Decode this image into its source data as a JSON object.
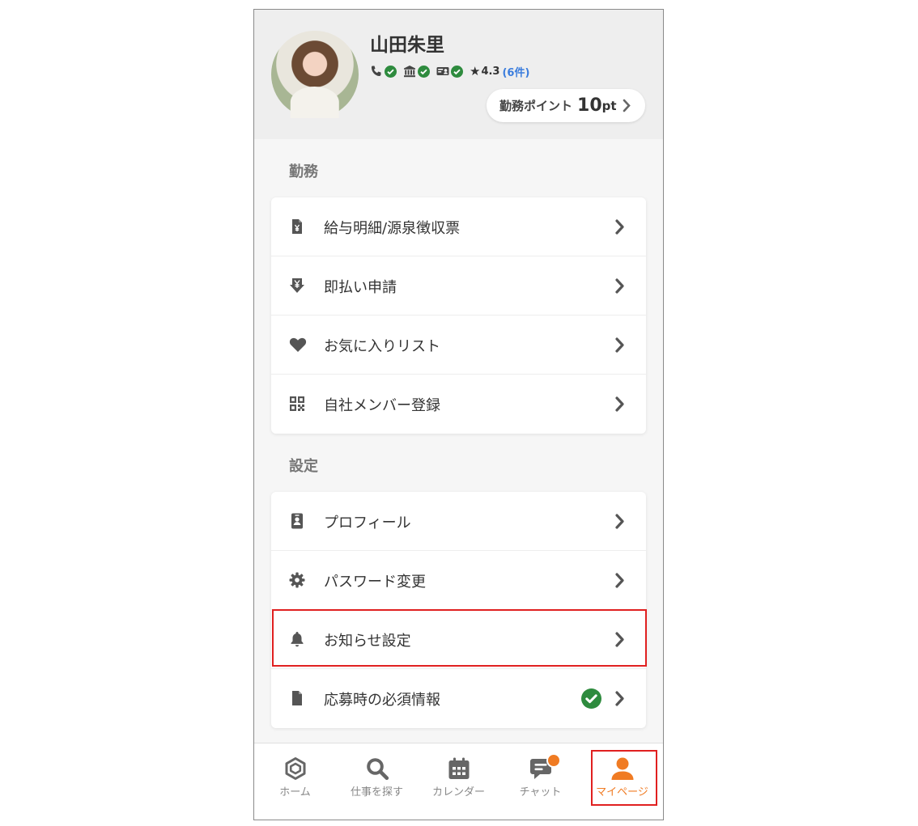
{
  "profile": {
    "name": "山田朱里",
    "verifications": [
      "phone-icon",
      "bank-icon",
      "id-card-icon"
    ],
    "rating": "4.3",
    "review_count": "(6件)",
    "points_label": "勤務ポイント",
    "points_value": "10",
    "points_unit": "pt"
  },
  "sections": {
    "work": {
      "title": "勤務",
      "items": [
        {
          "label": "給与明細/源泉徴収票",
          "icon": "receipt-yen-icon"
        },
        {
          "label": "即払い申請",
          "icon": "yen-download-icon"
        },
        {
          "label": "お気に入りリスト",
          "icon": "heart-icon"
        },
        {
          "label": "自社メンバー登録",
          "icon": "qr-code-icon"
        }
      ]
    },
    "settings": {
      "title": "設定",
      "items": [
        {
          "label": "プロフィール",
          "icon": "id-badge-icon"
        },
        {
          "label": "パスワード変更",
          "icon": "gear-icon"
        },
        {
          "label": "お知らせ設定",
          "icon": "bell-icon"
        },
        {
          "label": "応募時の必須情報",
          "icon": "file-icon",
          "completed": true
        }
      ]
    }
  },
  "nav": {
    "items": [
      {
        "label": "ホーム",
        "icon": "home-icon"
      },
      {
        "label": "仕事を探す",
        "icon": "search-icon"
      },
      {
        "label": "カレンダー",
        "icon": "calendar-icon"
      },
      {
        "label": "チャット",
        "icon": "chat-icon",
        "badge": true
      },
      {
        "label": "マイページ",
        "icon": "user-icon",
        "active": true
      }
    ]
  },
  "colors": {
    "accent": "#f07b23",
    "check": "#2e8b3e",
    "link": "#3b7ddd",
    "highlight": "#e02020",
    "icon": "#555555"
  }
}
